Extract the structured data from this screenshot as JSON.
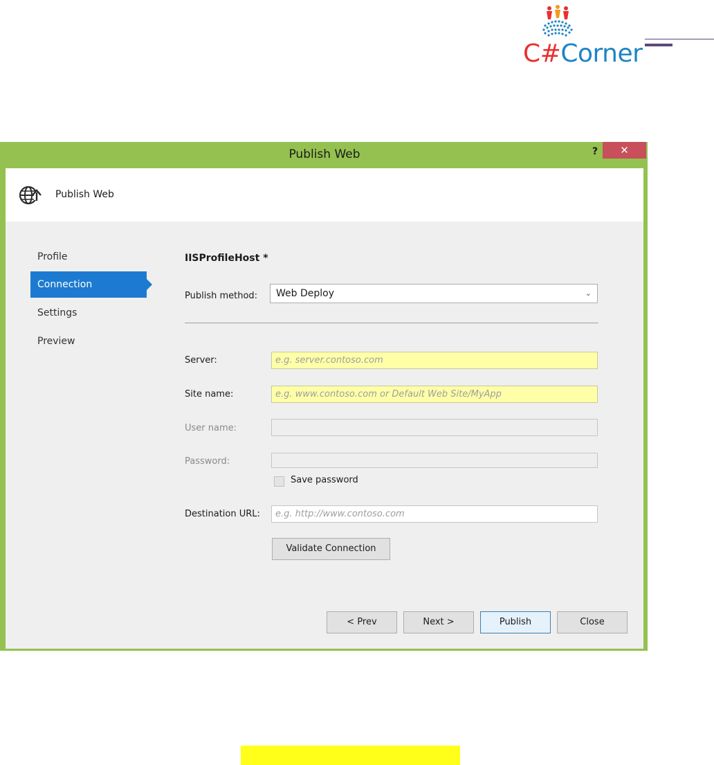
{
  "logo": {
    "text_c": "C#",
    "text_rest": "Corner"
  },
  "dialog": {
    "title": "Publish Web",
    "help_label": "?",
    "close_label": "✕",
    "header_title": "Publish Web"
  },
  "nav": {
    "items": [
      {
        "label": "Profile"
      },
      {
        "label": "Connection",
        "active": true
      },
      {
        "label": "Settings"
      },
      {
        "label": "Preview"
      }
    ]
  },
  "form": {
    "profile_name": "IISProfileHost *",
    "publish_method_label": "Publish method:",
    "publish_method_value": "Web Deploy",
    "server_label": "Server:",
    "server_placeholder": "e.g. server.contoso.com",
    "site_label": "Site name:",
    "site_placeholder": "e.g. www.contoso.com or Default Web Site/MyApp",
    "user_label": "User name:",
    "password_label": "Password:",
    "save_password_label": "Save password",
    "dest_label": "Destination URL:",
    "dest_placeholder": "e.g. http://www.contoso.com",
    "validate_label": "Validate Connection"
  },
  "buttons": {
    "prev": "< Prev",
    "next": "Next >",
    "publish": "Publish",
    "close": "Close"
  },
  "colors": {
    "frame": "#94c150",
    "nav_active": "#1c7bd0",
    "required_field": "#ffffa8",
    "close_button": "#c7505a",
    "highlight_bar": "#ffff1a"
  }
}
